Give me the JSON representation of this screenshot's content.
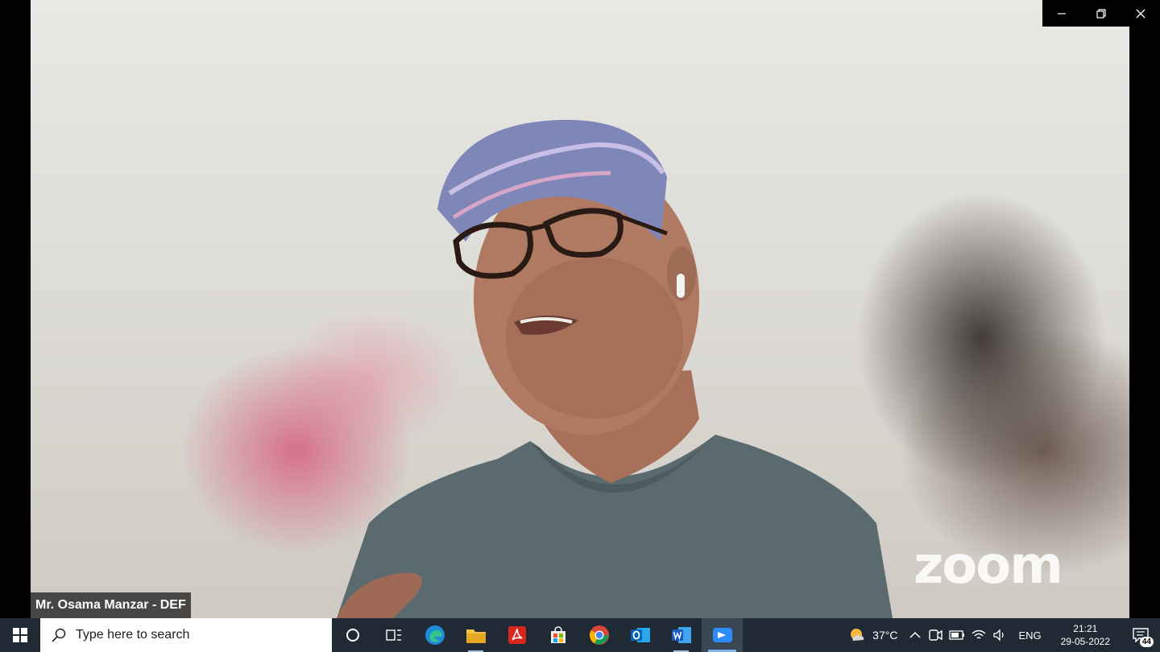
{
  "video": {
    "participant_name": "Mr. Osama Manzar - DEF",
    "watermark": "zoom"
  },
  "window_controls": [
    "minimize-icon",
    "restore-icon",
    "close-icon"
  ],
  "taskbar": {
    "search_placeholder": "Type here to search",
    "pinned_apps": [
      "cortana-icon",
      "task-view-icon",
      "edge-icon",
      "file-explorer-icon",
      "acrobat-icon",
      "microsoft-store-icon",
      "chrome-icon",
      "outlook-icon",
      "word-icon",
      "zoom-icon"
    ],
    "active_app": "zoom-icon"
  },
  "tray": {
    "temperature": "37°C",
    "language": "ENG",
    "time": "21:21",
    "date": "29-05-2022",
    "notification_count": "44"
  },
  "colors": {
    "taskbar_bg": "#1f2a35",
    "active_indicator": "#7fb4e6"
  }
}
